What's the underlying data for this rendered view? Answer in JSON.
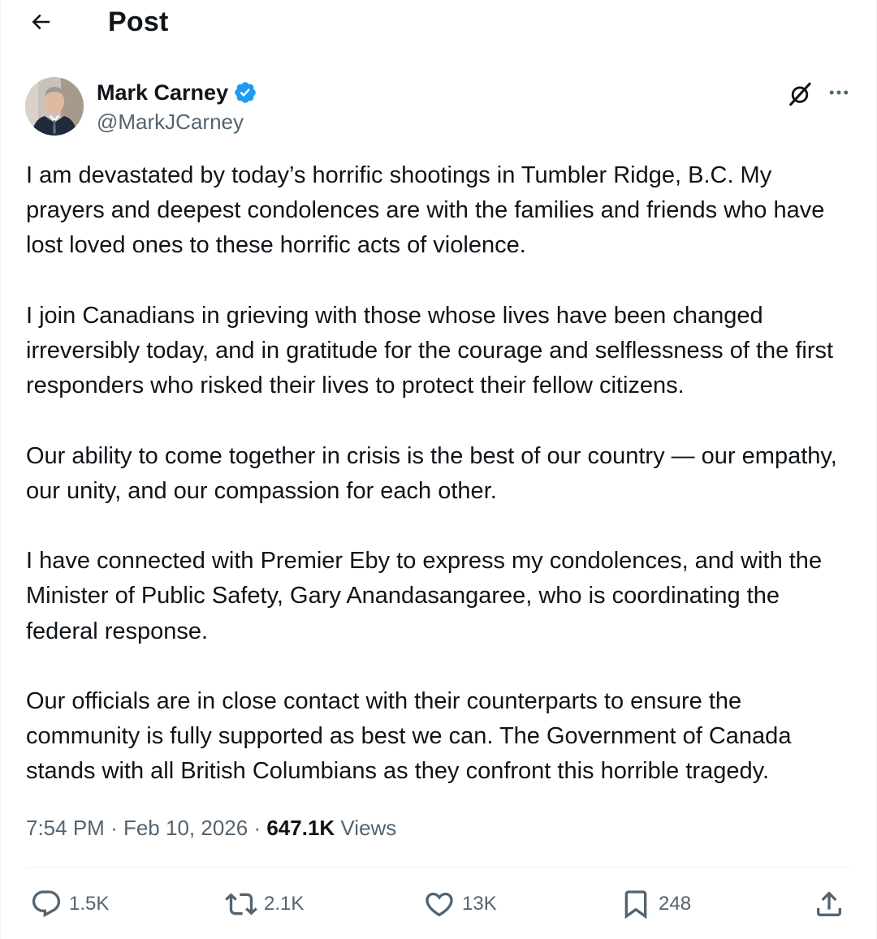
{
  "header": {
    "title": "Post",
    "back_icon": "arrow-left-icon"
  },
  "author": {
    "name": "Mark Carney",
    "handle": "@MarkJCarney",
    "verified": true,
    "verified_color": "#1d9bf0"
  },
  "post": {
    "paragraphs": [
      "I am devastated by today’s horrific shootings in Tumbler Ridge, B.C. My prayers and deepest condolences are with the families and friends who have lost loved ones to these horrific acts of violence.",
      "I join Canadians in grieving with those whose lives have been changed irreversibly today, and in gratitude for the courage and selflessness of the first responders who risked their lives to protect their fellow citizens.",
      "Our ability to come together in crisis is the best of our country — our empathy, our unity, and our compassion for each other.",
      "I have connected with Premier Eby to express my condolences, and with the Minister of Public Safety, Gary Anandasangaree, who is coordinating the federal response.",
      "Our officials are in close contact with their counterparts to ensure the community is fully supported as best we can. The Government of Canada stands with all British Columbians as they confront this horrible tragedy."
    ],
    "time": "7:54 PM",
    "separator": "·",
    "date": "Feb 10, 2026",
    "views_count": "647.1K",
    "views_label": "Views"
  },
  "actions": {
    "reply": {
      "icon": "reply-icon",
      "count": "1.5K"
    },
    "repost": {
      "icon": "repost-icon",
      "count": "2.1K"
    },
    "like": {
      "icon": "heart-icon",
      "count": "13K"
    },
    "bookmark": {
      "icon": "bookmark-icon",
      "count": "248"
    },
    "share": {
      "icon": "share-icon"
    }
  },
  "colors": {
    "text": "#0f1419",
    "secondary": "#536471",
    "divider": "#eff3f4",
    "accent": "#1d9bf0"
  }
}
